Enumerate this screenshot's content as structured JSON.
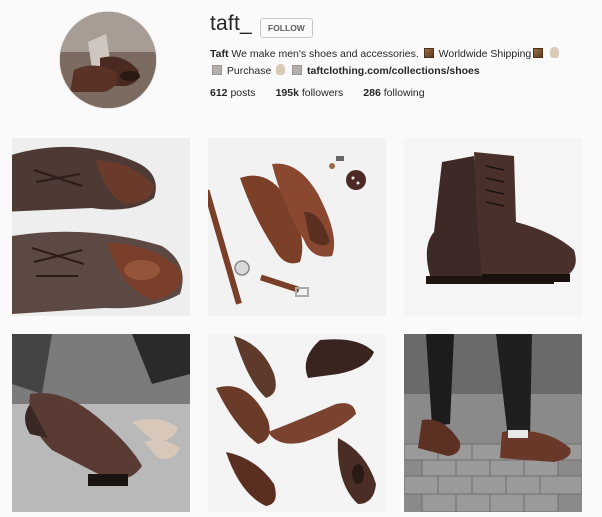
{
  "profile": {
    "username": "taft_",
    "follow_label": "FOLLOW",
    "bio": {
      "name": "Taft",
      "text1": "We make men's shoes and accessories.",
      "text2": "Worldwide Shipping",
      "text3": "Purchase",
      "link": "taftclothing.com/collections/shoes"
    },
    "stats": {
      "posts_count": "612",
      "posts_label": "posts",
      "followers_count": "195k",
      "followers_label": "followers",
      "following_count": "286",
      "following_label": "following"
    }
  },
  "posts": [
    {
      "subject": "dress-shoes-closeup"
    },
    {
      "subject": "flat-lay-shoes-belt-watch"
    },
    {
      "subject": "dark-cap-toe-boot"
    },
    {
      "subject": "man-tying-boot"
    },
    {
      "subject": "shoes-scattered"
    },
    {
      "subject": "walking-on-bricks"
    }
  ],
  "colors": {
    "background": "#fafafa",
    "leather_brown": "#6b3a28",
    "dark_leather": "#3b2622"
  }
}
